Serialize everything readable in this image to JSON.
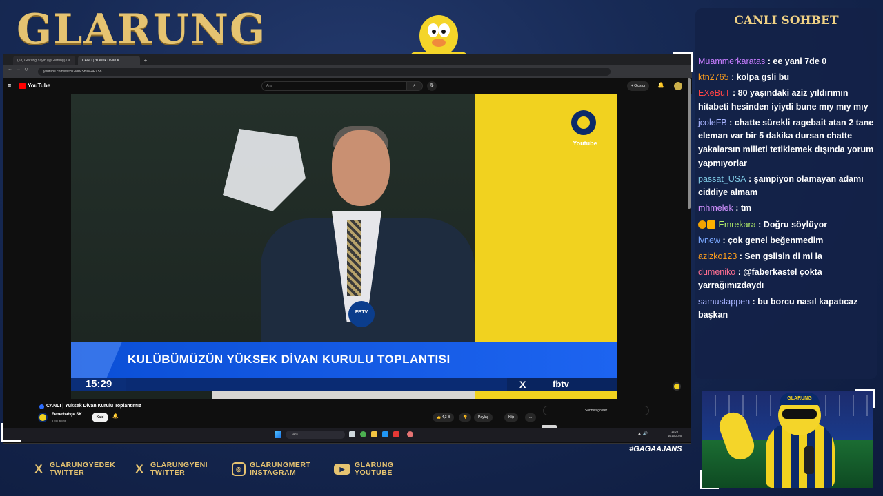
{
  "brand": {
    "title": "GLARUNG"
  },
  "browser": {
    "tabs": [
      {
        "label": "(18) Glarung Yayın (@Glarung) / X"
      },
      {
        "label": "CANLI | Yüksek Divan K..."
      }
    ],
    "url": "youtube.com/watch?v=MSbuV-4RX58"
  },
  "youtube": {
    "logo_label": "YouTube",
    "search_placeholder": "Ara",
    "create_label": "+ Oluştur",
    "video_title": "CANLI | Yüksek Divan Kurulu Toplantımız",
    "channel_name": "Fenerbahçe SK",
    "channel_subs": "3 Mn abone",
    "join_label": "Katıl",
    "likes": "4,3 B",
    "share_label": "Paylaş",
    "clip_label": "Klip",
    "more_label": "...",
    "chat_toggle_label": "Sohbeti göster"
  },
  "video": {
    "watermark": "Youtube",
    "banner_text": "KULÜBÜMÜZÜN YÜKSEK DİVAN KURULU TOPLANTISI",
    "clock": "15:29",
    "x_label": "X",
    "fbtv_label": "fbtv",
    "mic_label": "FBTV"
  },
  "taskbar": {
    "search_placeholder": "Ara",
    "time": "15:29",
    "date": "16.10.2025"
  },
  "chat": {
    "title": "CANLI SOHBET",
    "messages": [
      {
        "user": "Muammerkaratas",
        "color": "#c77dff",
        "text": ": ee yani 7de 0"
      },
      {
        "user": "ktn2765",
        "color": "#ff9f1c",
        "text": ": kolpa gsli bu"
      },
      {
        "user": "EXeBuT",
        "color": "#ff4444",
        "text": ": 80 yaşındaki aziz yıldırımın hitabeti hesinden iyiydi bune mıy mıy mıy"
      },
      {
        "user": "jcoleFB",
        "color": "#a8b4ff",
        "text": ": chatte sürekli ragebait atan 2 tane eleman var bir 5 dakika dursan chatte yakalarsın milleti tetiklemek dışında yorum yapmıyorlar"
      },
      {
        "user": "passat_USA",
        "color": "#7ec8e3",
        "text": ": şampiyon olamayan adamı ciddiye almam"
      },
      {
        "user": "mhmelek",
        "color": "#d291ff",
        "text": ": tm"
      },
      {
        "user": "Emrekara",
        "color": "#b4f06a",
        "text": ": Doğru söylüyor",
        "badges": true
      },
      {
        "user": "lvnew",
        "color": "#7aa7ff",
        "text": ": çok genel beğenmedim"
      },
      {
        "user": "azizko123",
        "color": "#ff9f1c",
        "text": ": Sen gslisin di mi la"
      },
      {
        "user": "dumeniko",
        "color": "#ff6f91",
        "text": ": @faberkastel çokta yarrağımızdaydı"
      },
      {
        "user": "samustappen",
        "color": "#a8b4ff",
        "text": ": bu borcu nasıl kapatıcaz başkan"
      }
    ]
  },
  "cam": {
    "hat_label": "GLARUNG"
  },
  "hashtag": "#GAGAAJANS",
  "socials": [
    {
      "icon": "x-icon",
      "line1": "GLARUNGYEDEK",
      "line2": "TWITTER"
    },
    {
      "icon": "x-icon",
      "line1": "GLARUNGYENI",
      "line2": "TWITTER"
    },
    {
      "icon": "instagram-icon",
      "line1": "GLARUNGMERT",
      "line2": "INSTAGRAM"
    },
    {
      "icon": "youtube-icon",
      "line1": "GLARUNG",
      "line2": "YOUTUBE"
    }
  ],
  "colors": {
    "accent_gold": "#e5c371",
    "fb_yellow": "#f1d21f",
    "fb_navy": "#0b2a6a",
    "banner_blue": "#0b4fd6"
  }
}
